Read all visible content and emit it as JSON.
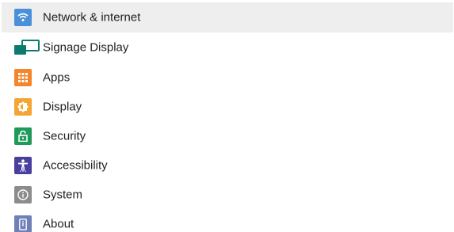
{
  "menu": {
    "items": [
      {
        "label": "Network & internet",
        "icon": "wifi-icon",
        "color": "#4a90d9",
        "selected": true
      },
      {
        "label": "Signage Display",
        "icon": "display-screen-icon",
        "color": "#0c7b6e",
        "selected": false
      },
      {
        "label": "Apps",
        "icon": "apps-grid-icon",
        "color": "#f4852a",
        "selected": false
      },
      {
        "label": "Display",
        "icon": "brightness-icon",
        "color": "#f4a534",
        "selected": false
      },
      {
        "label": "Security",
        "icon": "lock-icon",
        "color": "#1e9a5a",
        "selected": false
      },
      {
        "label": "Accessibility",
        "icon": "accessibility-icon",
        "color": "#4a3fa0",
        "selected": false
      },
      {
        "label": "System",
        "icon": "info-icon",
        "color": "#8c8c8c",
        "selected": false
      },
      {
        "label": "About",
        "icon": "phone-icon",
        "color": "#6f7fb7",
        "selected": false
      }
    ]
  }
}
